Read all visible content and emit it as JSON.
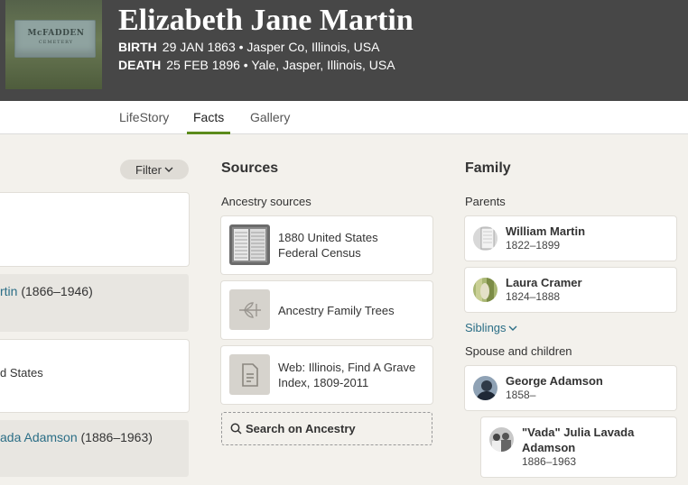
{
  "person": {
    "name": "Elizabeth Jane Martin",
    "birth_label": "BIRTH",
    "birth_value": "29 JAN 1863 • Jasper Co, Illinois, USA",
    "death_label": "DEATH",
    "death_value": "25 FEB 1896 • Yale, Jasper, Illinois, USA",
    "photo": {
      "headstone_text": "McFADDEN",
      "headstone_sub": "CEMETERY"
    }
  },
  "tabs": [
    {
      "label": "LifeStory",
      "active": false
    },
    {
      "label": "Facts",
      "active": true
    },
    {
      "label": "Gallery",
      "active": false
    }
  ],
  "events": {
    "filter_label": "Filter",
    "items": [
      {
        "link": "",
        "years": ""
      },
      {
        "link": "rtin",
        "years": "(1866–1946)"
      },
      {
        "link": "",
        "years": "",
        "text": "d States"
      },
      {
        "link": "ada Adamson",
        "years": "(1886–1963)"
      }
    ]
  },
  "sources": {
    "title": "Sources",
    "ancestry_label": "Ancestry sources",
    "items": [
      {
        "text": "1880 United States Federal Census",
        "icon": "census-document-icon"
      },
      {
        "text": "Ancestry Family Trees",
        "icon": "family-tree-leaf-icon"
      },
      {
        "text": "Web: Illinois, Find A Grave Index, 1809-2011",
        "icon": "document-icon"
      }
    ],
    "search_label": "Search on Ancestry"
  },
  "family": {
    "title": "Family",
    "parents_label": "Parents",
    "parents": [
      {
        "name": "William Martin",
        "years": "1822–1899"
      },
      {
        "name": "Laura Cramer",
        "years": "1824–1888"
      }
    ],
    "siblings_label": "Siblings",
    "spouse_label": "Spouse and children",
    "spouse": {
      "name": "George Adamson",
      "years": "1858–"
    },
    "children": [
      {
        "name": "\"Vada\" Julia Lavada Adamson",
        "years": "1886–1963"
      }
    ]
  },
  "colors": {
    "header_bg": "#474747",
    "page_bg": "#f3f1ec",
    "link": "#2b6e86",
    "tab_active": "#5b8b1b"
  }
}
